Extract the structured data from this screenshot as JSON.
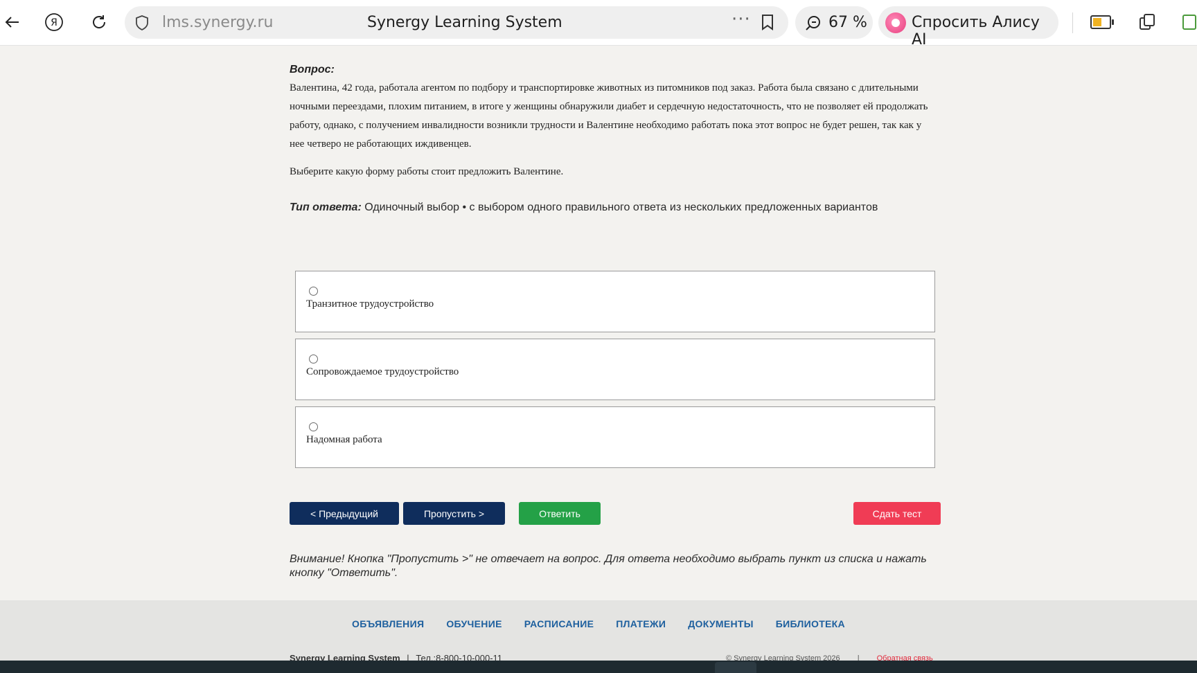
{
  "browser": {
    "url": "lms.synergy.ru",
    "page_title": "Synergy Learning System",
    "zoom": "67 %",
    "alice_label": "Спросить Алису AI",
    "more_dots": "···"
  },
  "question": {
    "label": "Вопрос:",
    "text": "Валентина, 42 года, работала агентом по подбору и транспортировке животных из питомников под заказ. Работа была связано с длительными ночными переездами, плохим питанием, в итоге у женщины обнаружили диабет и сердечную недостаточность, что не позволяет ей продолжать работу, однако, с получением инвалидности возникли трудности и Валентине необходимо работать пока этот вопрос не будет решен, так как у нее четверо не работающих иждивенцев.",
    "prompt": "Выберите какую форму работы стоит предложить Валентине.",
    "answer_type_label": "Тип ответа:",
    "answer_type_value": "Одиночный выбор • с выбором одного правильного ответа из нескольких предложенных вариантов"
  },
  "options": [
    {
      "label": "Транзитное трудоустройство"
    },
    {
      "label": "Сопровождаемое трудоустройство"
    },
    {
      "label": "Надомная работа"
    }
  ],
  "buttons": {
    "prev": "< Предыдущий",
    "skip": "Пропустить >",
    "answer": "Ответить",
    "submit": "Сдать тест"
  },
  "notice": "Внимание! Кнопка \"Пропустить >\" не отвечает на вопрос. Для ответа необходимо выбрать пункт из списка и нажать кнопку \"Ответить\".",
  "footer": {
    "nav": [
      "ОБЪЯВЛЕНИЯ",
      "ОБУЧЕНИЕ",
      "РАСПИСАНИЕ",
      "ПЛАТЕЖИ",
      "ДОКУМЕНТЫ",
      "БИБЛИОТЕКА"
    ],
    "brand": "Synergy Learning System",
    "phone": "Тел.:8-800-10-000-11",
    "copyright": "© Synergy Learning System 2026",
    "divider": "|",
    "feedback": "Обратная связь"
  },
  "colors": {
    "primary_button": "#0f2d5c",
    "answer_button": "#24a147",
    "submit_button": "#f03c55",
    "footer_link": "#1d5f9e"
  },
  "icons": [
    "back-arrow-icon",
    "yandex-logo-icon",
    "reload-icon",
    "shield-icon",
    "bookmark-icon",
    "search-zoom-icon",
    "alice-orb-icon",
    "battery-icon",
    "extension-icon"
  ]
}
